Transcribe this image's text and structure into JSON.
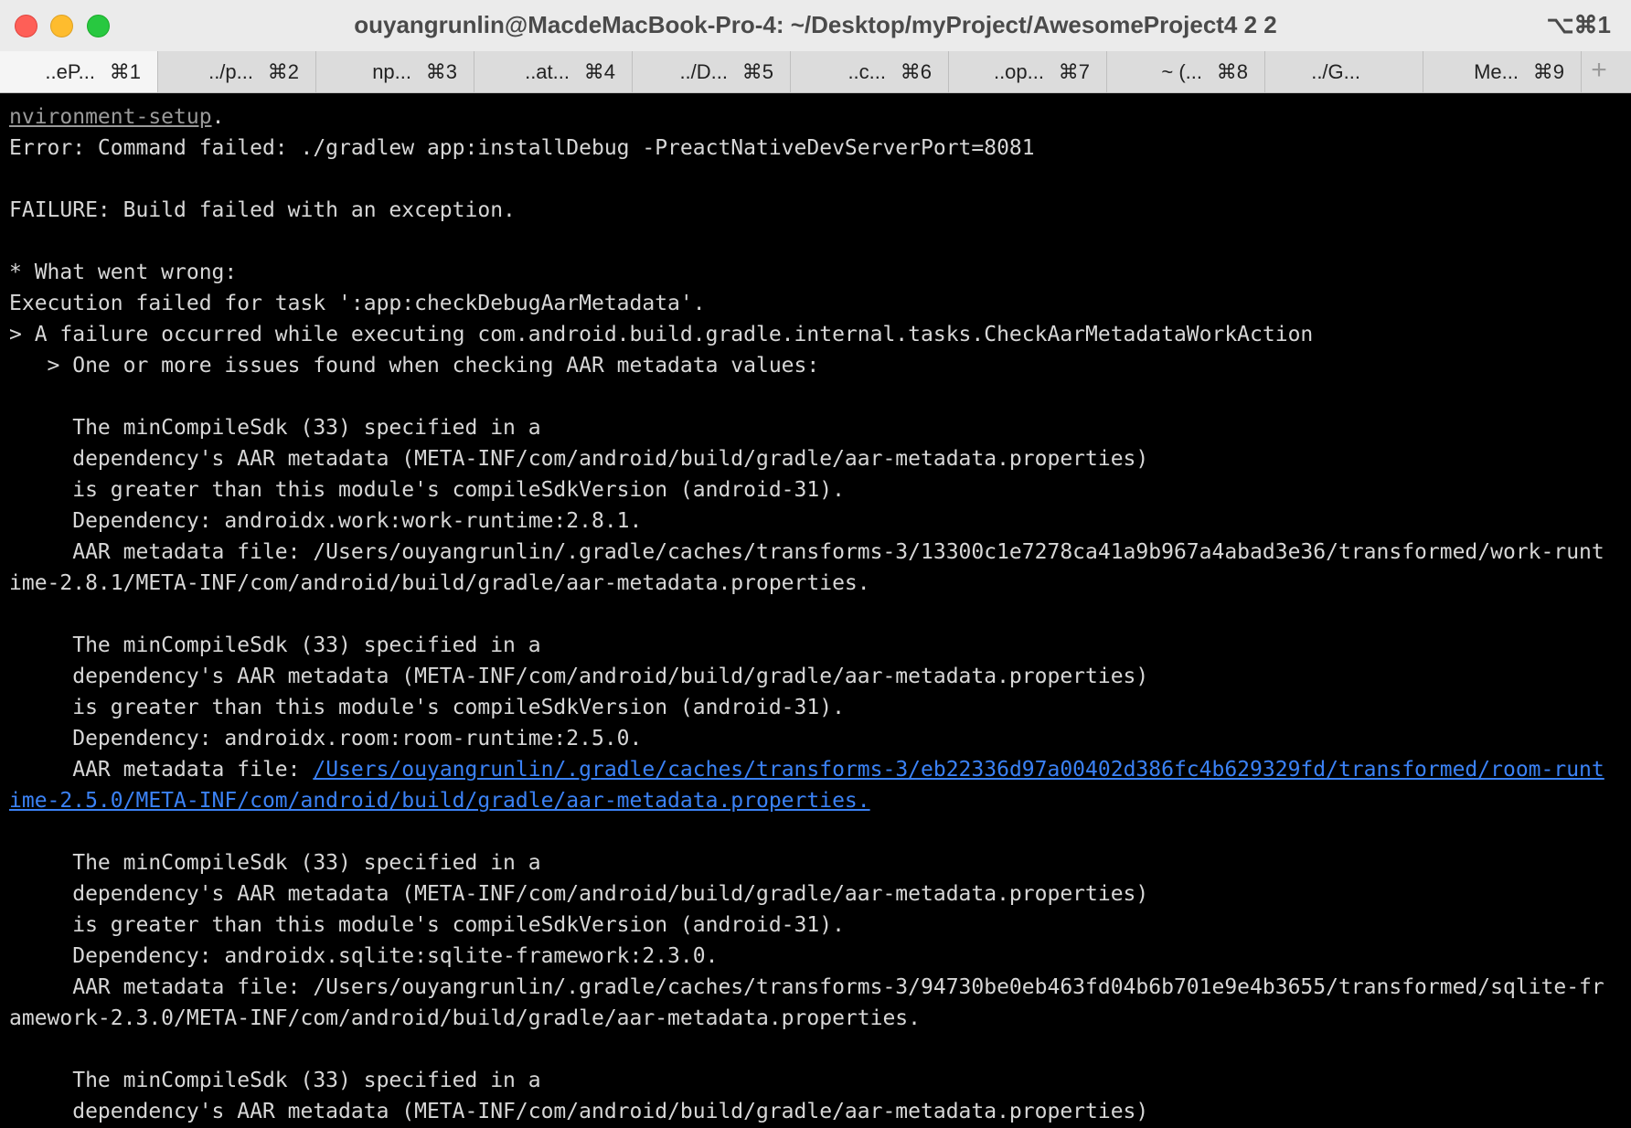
{
  "window": {
    "title": "ouyangrunlin@MacdeMacBook-Pro-4: ~/Desktop/myProject/AwesomeProject4 2 2",
    "shortcut": "⌥⌘1"
  },
  "tabs": [
    {
      "label": "..eP...",
      "key": "⌘1",
      "active": true
    },
    {
      "label": "../p...",
      "key": "⌘2",
      "active": false
    },
    {
      "label": "np...",
      "key": "⌘3",
      "active": false
    },
    {
      "label": "..at...",
      "key": "⌘4",
      "active": false
    },
    {
      "label": "../D...",
      "key": "⌘5",
      "active": false
    },
    {
      "label": "..c...",
      "key": "⌘6",
      "active": false
    },
    {
      "label": "..op...",
      "key": "⌘7",
      "active": false
    },
    {
      "label": "~ (...",
      "key": "⌘8",
      "active": false
    },
    {
      "label": "../G...",
      "key": "",
      "active": false
    },
    {
      "label": "Me...",
      "key": "⌘9",
      "active": false
    }
  ],
  "new_tab_label": "+",
  "terminal": {
    "link_prefix": "nvironment-setup",
    "link_suffix": ".",
    "lines": [
      "Error: Command failed: ./gradlew app:installDebug -PreactNativeDevServerPort=8081",
      "",
      "FAILURE: Build failed with an exception.",
      "",
      "* What went wrong:",
      "Execution failed for task ':app:checkDebugAarMetadata'.",
      "> A failure occurred while executing com.android.build.gradle.internal.tasks.CheckAarMetadataWorkAction",
      "   > One or more issues found when checking AAR metadata values:",
      "",
      "     The minCompileSdk (33) specified in a",
      "     dependency's AAR metadata (META-INF/com/android/build/gradle/aar-metadata.properties)",
      "     is greater than this module's compileSdkVersion (android-31).",
      "     Dependency: androidx.work:work-runtime:2.8.1.",
      "     AAR metadata file: /Users/ouyangrunlin/.gradle/caches/transforms-3/13300c1e7278ca41a9b967a4abad3e36/transformed/work-runt",
      "ime-2.8.1/META-INF/com/android/build/gradle/aar-metadata.properties.",
      "",
      "     The minCompileSdk (33) specified in a",
      "     dependency's AAR metadata (META-INF/com/android/build/gradle/aar-metadata.properties)",
      "     is greater than this module's compileSdkVersion (android-31).",
      "     Dependency: androidx.room:room-runtime:2.5.0."
    ],
    "link_line_label": "     AAR metadata file: ",
    "link_line_url": "/Users/ouyangrunlin/.gradle/caches/transforms-3/eb22336d97a00402d386fc4b629329fd/transformed/room-runt",
    "link_line_continued": "ime-2.5.0/META-INF/com/android/build/gradle/aar-metadata.properties.",
    "lines_after": [
      "",
      "     The minCompileSdk (33) specified in a",
      "     dependency's AAR metadata (META-INF/com/android/build/gradle/aar-metadata.properties)",
      "     is greater than this module's compileSdkVersion (android-31).",
      "     Dependency: androidx.sqlite:sqlite-framework:2.3.0.",
      "     AAR metadata file: /Users/ouyangrunlin/.gradle/caches/transforms-3/94730be0eb463fd04b6b701e9e4b3655/transformed/sqlite-fr",
      "amework-2.3.0/META-INF/com/android/build/gradle/aar-metadata.properties.",
      "",
      "     The minCompileSdk (33) specified in a",
      "     dependency's AAR metadata (META-INF/com/android/build/gradle/aar-metadata.properties)"
    ]
  }
}
